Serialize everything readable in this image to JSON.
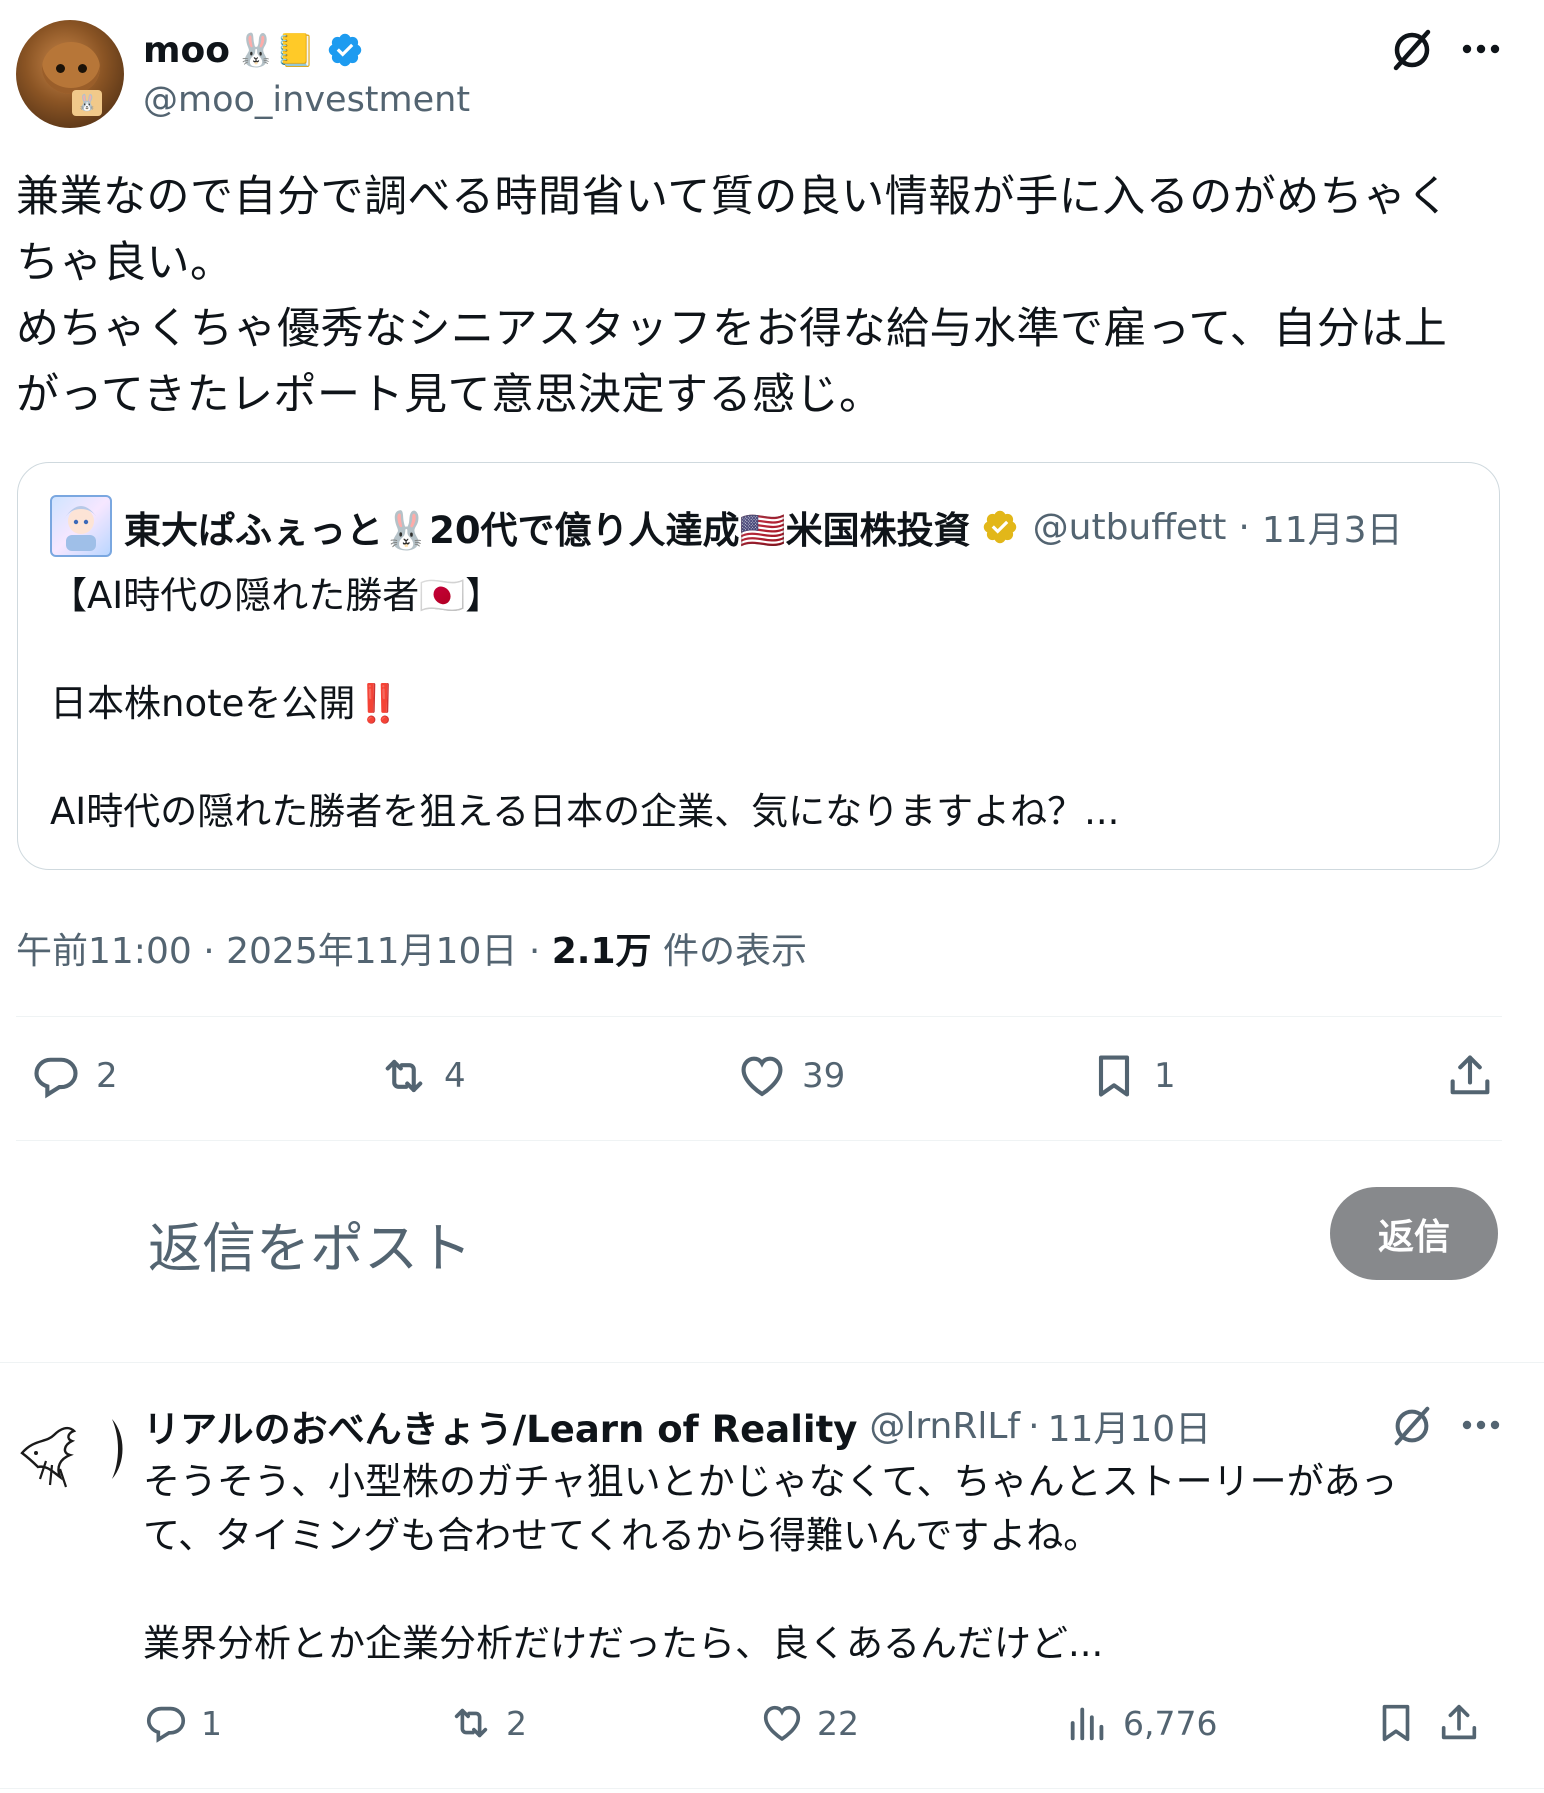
{
  "post": {
    "author_name": "moo",
    "author_emoji": "🐰📒",
    "author_handle": "@moo_investment",
    "text_lines": [
      "兼業なので自分で調べる時間省いて質の良い情報が手に入るのがめちゃく",
      "ちゃ良い。",
      "めちゃくちゃ優秀なシニアスタッフをお得な給与水準で雇って、自分は上",
      "がってきたレポート見て意思決定する感じ。"
    ],
    "time": "午前11:00",
    "date": "2025年11月10日",
    "views_count": "2.1万",
    "views_label": "件の表示",
    "sep": "·"
  },
  "quote": {
    "author_name": "東大ぱふぇっと🐰20代で億り人達成🇺🇸米国株投資",
    "author_handle": "@utbuffett",
    "date": "11月3日",
    "line1": "【AI時代の隠れた勝者🇯🇵】",
    "line2": "日本株noteを公開‼️",
    "line3": "AI時代の隠れた勝者を狙える日本の企業、気になりますよね？..."
  },
  "actions": {
    "replies": "2",
    "reposts": "4",
    "likes": "39",
    "bookmarks": "1"
  },
  "reply_box": {
    "placeholder": "返信をポスト",
    "button_label": "返信"
  },
  "reply": {
    "author_name": "リアルのおべんきょう/Learn of Reality",
    "author_handle": "@lrnRlLf",
    "date": "11月10日",
    "line1": "そうそう、小型株のガチャ狙いとかじゃなくて、ちゃんとストーリーがあっ",
    "line2": "て、タイミングも合わせてくれるから得難いんですよね。",
    "line3": "業界分析とか企業分析だけだったら、良くあるんだけど...",
    "replies": "1",
    "reposts": "2",
    "likes": "22",
    "views": "6,776"
  },
  "colors": {
    "text": "#0f1419",
    "secondary": "#536471",
    "border": "#cfd9de",
    "verified": "#1d9bf0",
    "verified_gold": "#e2b719",
    "reply_button": "#87898c"
  }
}
